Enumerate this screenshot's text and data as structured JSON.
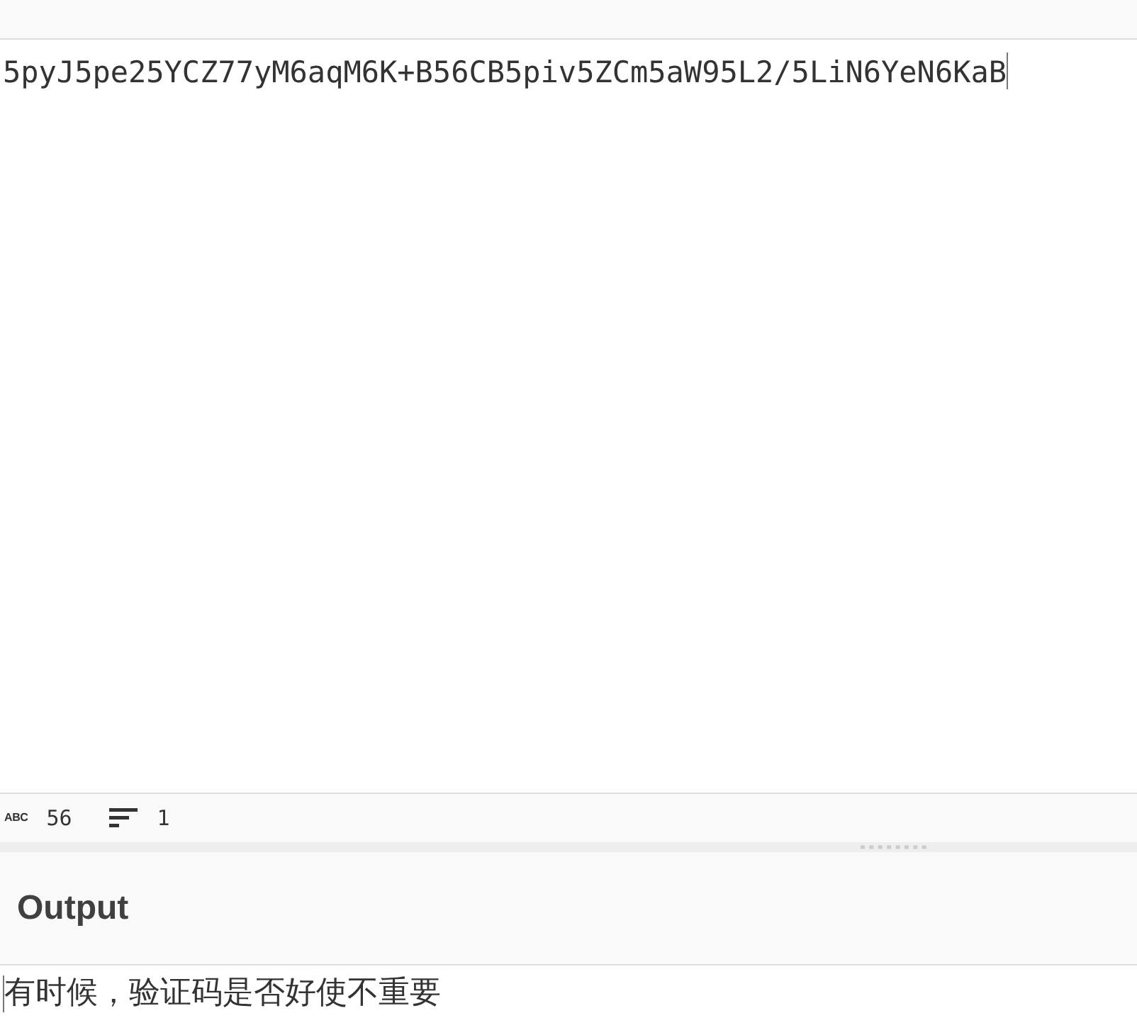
{
  "input": {
    "value": "5pyJ5pe25YCZ77yM6aqM6K+B56CB5piv5ZCm5aW95L2/5LiN6YeN6KaB"
  },
  "status_bar": {
    "char_icon": "ABC",
    "char_count": "56",
    "line_count": "1"
  },
  "output": {
    "title": "Output",
    "value": "有时候，验证码是否好使不重要"
  }
}
